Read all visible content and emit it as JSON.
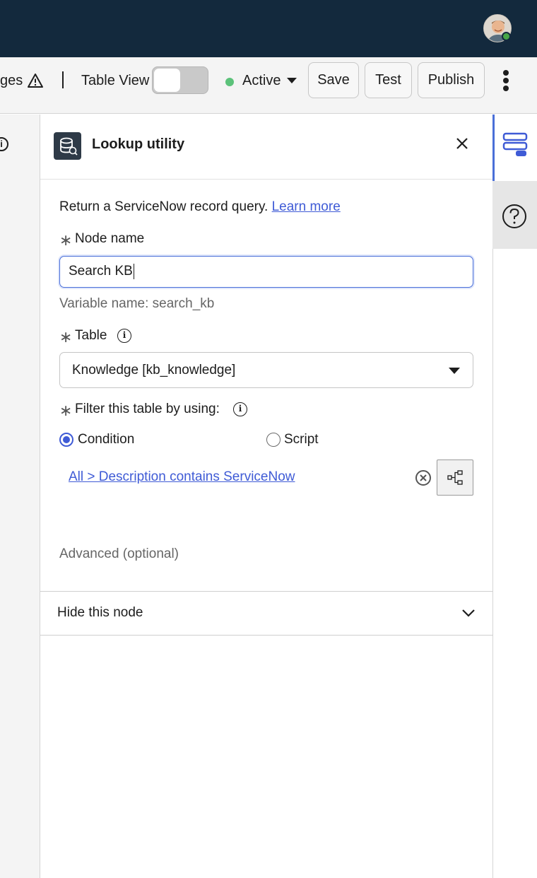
{
  "toolbar": {
    "changes_label": "ges",
    "table_view_label": "Table View",
    "status_label": "Active",
    "save_label": "Save",
    "test_label": "Test",
    "publish_label": "Publish"
  },
  "panel": {
    "title": "Lookup utility",
    "description": "Return a ServiceNow record query.",
    "learn_more": "Learn more",
    "node_name_label": "Node name",
    "node_name_value": "Search KB",
    "variable_hint": "Variable name: search_kb",
    "table_label": "Table",
    "table_value": "Knowledge [kb_knowledge]",
    "filter_label": "Filter this table by using:",
    "option_condition": "Condition",
    "option_script": "Script",
    "condition_text": "All > Description contains ServiceNow",
    "advanced_label": "Advanced (optional)",
    "hide_node_label": "Hide this node"
  },
  "colors": {
    "topbar": "#13293d",
    "accent": "#3f5bd6",
    "status_active": "#5cc27a"
  },
  "icons": {
    "warning": "warning-triangle-icon",
    "panel": "database-icon",
    "close": "close-icon",
    "help": "help-circle-icon",
    "rail_active": "layers-icon",
    "clear": "clear-circle-icon",
    "tree": "condition-tree-icon",
    "chevron": "chevron-down-icon"
  }
}
